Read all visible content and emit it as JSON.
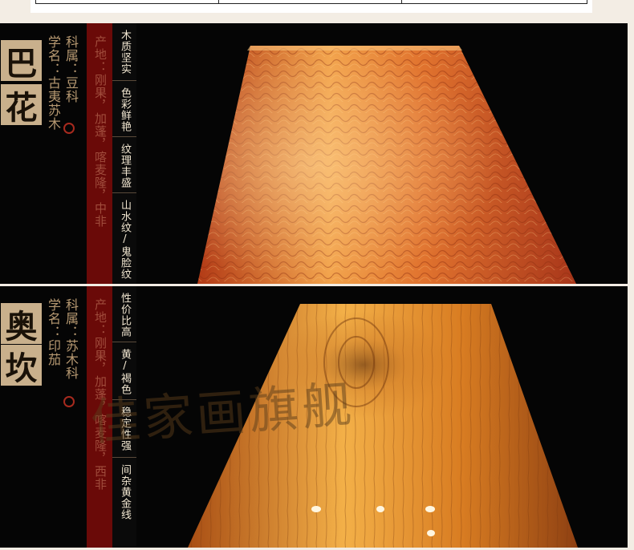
{
  "panels": [
    {
      "name_chars": [
        "巴",
        "花"
      ],
      "family_line": "科属：豆科",
      "sci_line": "学名：古夷苏木",
      "origin_line": "产地：刚果，加蓬，喀麦隆，中非",
      "features": [
        "木质坚实",
        "色彩鲜艳",
        "纹理丰盛",
        "山水纹/鬼脸纹"
      ],
      "wood_colors": {
        "light": "#f0a04a",
        "mid": "#d9612a",
        "dark": "#a8361a"
      }
    },
    {
      "name_chars": [
        "奥",
        "坎"
      ],
      "family_line": "科属：苏木科",
      "sci_line": "学名：印茄",
      "origin_line": "产地：刚果，加蓬，喀麦隆，西非",
      "features": [
        "性价比高",
        "黄/褐色",
        "稳定性强",
        "间杂黄金线"
      ],
      "wood_colors": {
        "light": "#f3b048",
        "mid": "#d97d22",
        "dark": "#9a4a14"
      },
      "watermark": "佳家画旗舰"
    }
  ],
  "theme": {
    "name_box": "#c9b08c",
    "red_band": "#6a0a08",
    "gold_text": "#b89a72"
  }
}
